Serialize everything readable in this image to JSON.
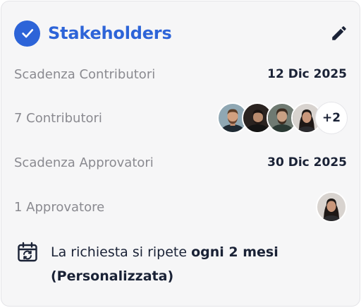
{
  "colors": {
    "accent": "#2d64d8",
    "text_dark": "#1a2236",
    "text_muted": "#8a8a90",
    "card_bg": "#f6f6f7"
  },
  "header": {
    "title": "Stakeholders",
    "check_icon": "check-circle-icon",
    "edit_icon": "pencil-icon"
  },
  "contributors_deadline": {
    "label": "Scadenza Contributori",
    "value": "12 Dic 2025"
  },
  "contributors": {
    "label": "7 Contributori",
    "more_label": "+2",
    "avatars": [
      "contributor-1",
      "contributor-2",
      "contributor-3",
      "contributor-4"
    ]
  },
  "approvers_deadline": {
    "label": "Scadenza Approvatori",
    "value": "30 Dic 2025"
  },
  "approvers": {
    "label": "1 Approvatore",
    "avatars": [
      "approver-1"
    ]
  },
  "recurrence": {
    "icon": "calendar-repeat-icon",
    "prefix": "La richiesta si ripete ",
    "frequency": "ogni 2 mesi",
    "type": "(Personalizzata)"
  }
}
